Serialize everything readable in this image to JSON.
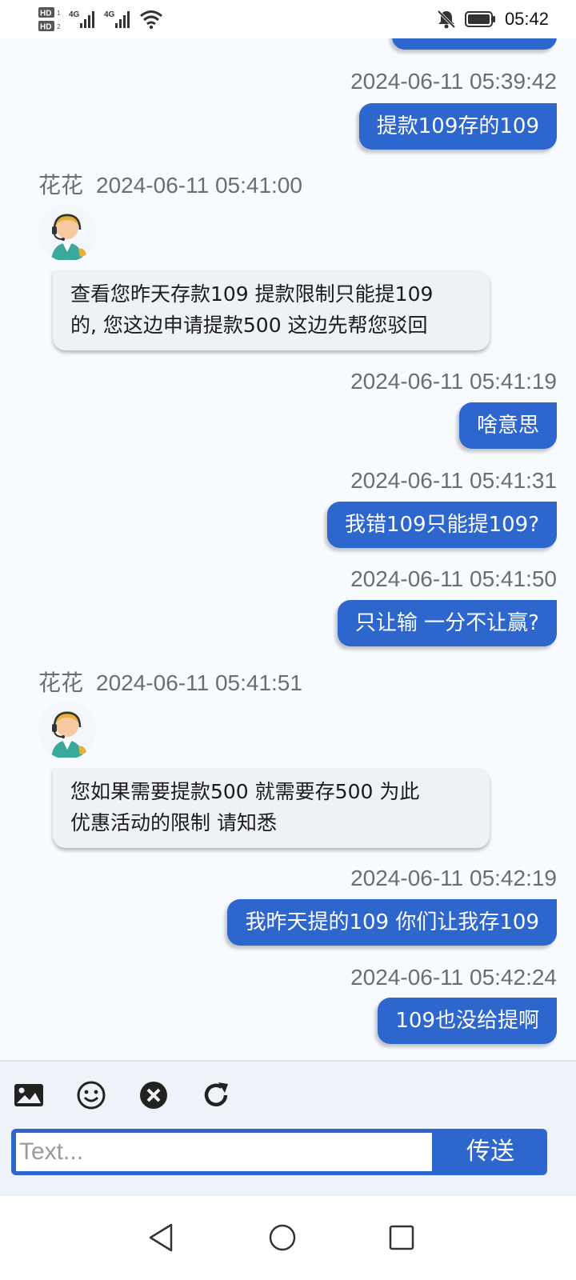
{
  "status_bar": {
    "network_left_top": "HD",
    "network_left_bottom": "HD",
    "signal_1_label": "4G",
    "signal_2_label": "4G",
    "time": "05:42",
    "icons": [
      "hd-icon",
      "signal-icon",
      "signal-icon",
      "wifi-icon",
      "mute-bell-icon",
      "battery-icon"
    ]
  },
  "messages": [
    {
      "type": "out",
      "timestamp": "2024-06-11 05:39:42",
      "text": "提款109存的109"
    },
    {
      "type": "in",
      "sender": "花花",
      "timestamp": "2024-06-11 05:41:00",
      "lines": [
        "查看您昨天存款109 提款限制只能提109",
        "的, 您这边申请提款500 这边先帮您驳回"
      ]
    },
    {
      "type": "out",
      "timestamp": "2024-06-11 05:41:19",
      "text": "啥意思"
    },
    {
      "type": "out",
      "timestamp": "2024-06-11 05:41:31",
      "text": "我错109只能提109?"
    },
    {
      "type": "out",
      "timestamp": "2024-06-11 05:41:50",
      "text": "只让输 一分不让赢?"
    },
    {
      "type": "in",
      "sender": "花花",
      "timestamp": "2024-06-11 05:41:51",
      "lines": [
        "您如果需要提款500 就需要存500 为此",
        "优惠活动的限制 请知悉"
      ]
    },
    {
      "type": "out",
      "timestamp": "2024-06-11 05:42:19",
      "text": "我昨天提的109 你们让我存109"
    },
    {
      "type": "out",
      "timestamp": "2024-06-11 05:42:24",
      "text": "109也没给提啊"
    }
  ],
  "composer": {
    "tools": [
      "image-icon",
      "emoji-icon",
      "clear-icon",
      "refresh-icon"
    ],
    "input_placeholder": "Text...",
    "input_value": "",
    "send_label": "传送"
  },
  "colors": {
    "accent": "#2d66cc",
    "incoming_bubble": "#eef1f6",
    "background": "#f7fbff",
    "timestamp": "#6d6d6d"
  },
  "nav_bar": {
    "icons": [
      "back-icon",
      "home-icon",
      "recents-icon"
    ]
  }
}
